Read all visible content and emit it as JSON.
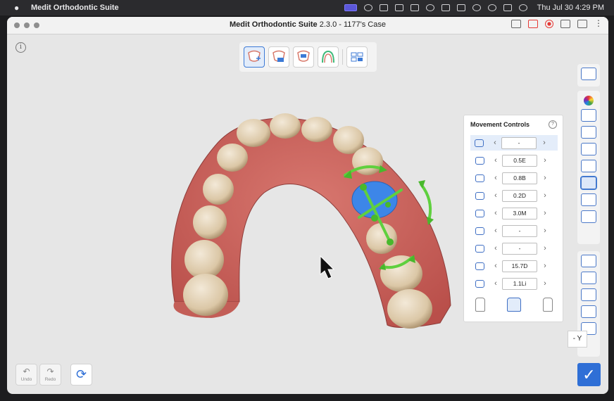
{
  "menubar": {
    "app_name": "Medit Orthodontic Suite",
    "clock": "Thu Jul 30  4:29 PM"
  },
  "window": {
    "app_title": "Medit Orthodontic Suite",
    "version_case": "2.3.0 - 1177's Case"
  },
  "info_label": "i",
  "movement_controls": {
    "title": "Movement Controls",
    "help_label": "?",
    "rows": [
      {
        "icon": "move-all-icon",
        "value": "-"
      },
      {
        "icon": "translate-icon",
        "value": "0.5E"
      },
      {
        "icon": "tip-icon",
        "value": "0.8B"
      },
      {
        "icon": "rotation-icon",
        "value": "0.2D"
      },
      {
        "icon": "torque-icon",
        "value": "3.0M"
      },
      {
        "icon": "extrusion-icon",
        "value": "-"
      },
      {
        "icon": "intrusion-icon",
        "value": "-"
      },
      {
        "icon": "angulation-icon",
        "value": "15.7D"
      },
      {
        "icon": "inclination-icon",
        "value": "1.1Li"
      }
    ]
  },
  "axis_label": "- Y",
  "undo_label": "Undo",
  "redo_label": "Redo",
  "colors": {
    "accent": "#2f6fd6",
    "gizmo": "#66d94a",
    "selected_tooth": "#3d86e8"
  }
}
